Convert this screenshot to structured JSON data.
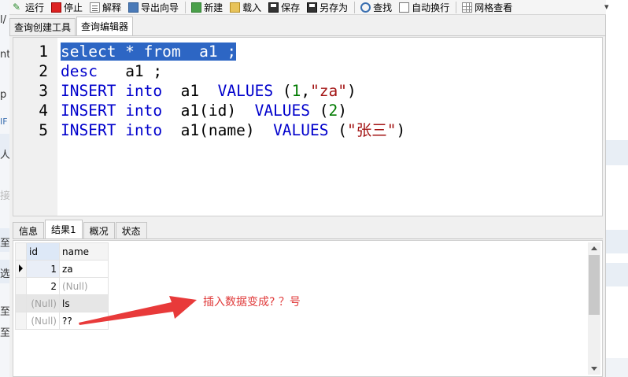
{
  "toolbar": {
    "run": "运行",
    "stop": "停止",
    "explain": "解释",
    "export_wizard": "导出向导",
    "new": "新建",
    "load": "载入",
    "save": "保存",
    "save_as": "另存为",
    "find": "查找",
    "auto_wrap": "自动换行",
    "grid_view": "网格查看"
  },
  "top_tabs": [
    {
      "label": "查询创建工具"
    },
    {
      "label": "查询编辑器"
    }
  ],
  "editor": {
    "line_numbers": [
      "1",
      "2",
      "3",
      "4",
      "5"
    ],
    "lines": [
      [
        {
          "t": "select * from  a1 ;",
          "c": "sel"
        }
      ],
      [
        {
          "t": "desc",
          "c": "kw"
        },
        {
          "t": "   a1 ;",
          "c": "plain"
        }
      ],
      [
        {
          "t": "INSERT",
          "c": "kw"
        },
        {
          "t": " ",
          "c": "plain"
        },
        {
          "t": "into",
          "c": "kw"
        },
        {
          "t": "  a1  ",
          "c": "plain"
        },
        {
          "t": "VALUES",
          "c": "kw"
        },
        {
          "t": " (",
          "c": "plain"
        },
        {
          "t": "1",
          "c": "num"
        },
        {
          "t": ",",
          "c": "plain"
        },
        {
          "t": "\"za\"",
          "c": "str"
        },
        {
          "t": ")",
          "c": "plain"
        }
      ],
      [
        {
          "t": "INSERT",
          "c": "kw"
        },
        {
          "t": " ",
          "c": "plain"
        },
        {
          "t": "into",
          "c": "kw"
        },
        {
          "t": "  a1(id)  ",
          "c": "plain"
        },
        {
          "t": "VALUES",
          "c": "kw"
        },
        {
          "t": " (",
          "c": "plain"
        },
        {
          "t": "2",
          "c": "num"
        },
        {
          "t": ")",
          "c": "plain"
        }
      ],
      [
        {
          "t": "INSERT",
          "c": "kw"
        },
        {
          "t": " ",
          "c": "plain"
        },
        {
          "t": "into",
          "c": "kw"
        },
        {
          "t": "  a1(name)  ",
          "c": "plain"
        },
        {
          "t": "VALUES",
          "c": "kw"
        },
        {
          "t": " (",
          "c": "plain"
        },
        {
          "t": "\"张三\"",
          "c": "str"
        },
        {
          "t": ")",
          "c": "plain"
        }
      ]
    ]
  },
  "bottom_tabs": [
    {
      "label": "信息"
    },
    {
      "label": "结果1"
    },
    {
      "label": "概况"
    },
    {
      "label": "状态"
    }
  ],
  "result": {
    "columns": [
      "id",
      "name"
    ],
    "rows": [
      {
        "id": "1",
        "name": "za",
        "id_null": false,
        "name_null": false
      },
      {
        "id": "2",
        "name": "(Null)",
        "id_null": false,
        "name_null": true
      },
      {
        "id": "(Null)",
        "name": "ls",
        "id_null": true,
        "name_null": false
      },
      {
        "id": "(Null)",
        "name": "??",
        "id_null": true,
        "name_null": false
      }
    ]
  },
  "annotation": {
    "text": "插入数据变成? ？号",
    "color": "#e03a3a"
  },
  "colors": {
    "keyword": "#0000cc",
    "string": "#a31515",
    "number": "#007a00",
    "selection": "#2d66c4"
  },
  "background_left_chars": [
    "l/",
    "nt",
    "p",
    "IF",
    "人",
    "接",
    "至",
    "选",
    "至",
    "至"
  ]
}
